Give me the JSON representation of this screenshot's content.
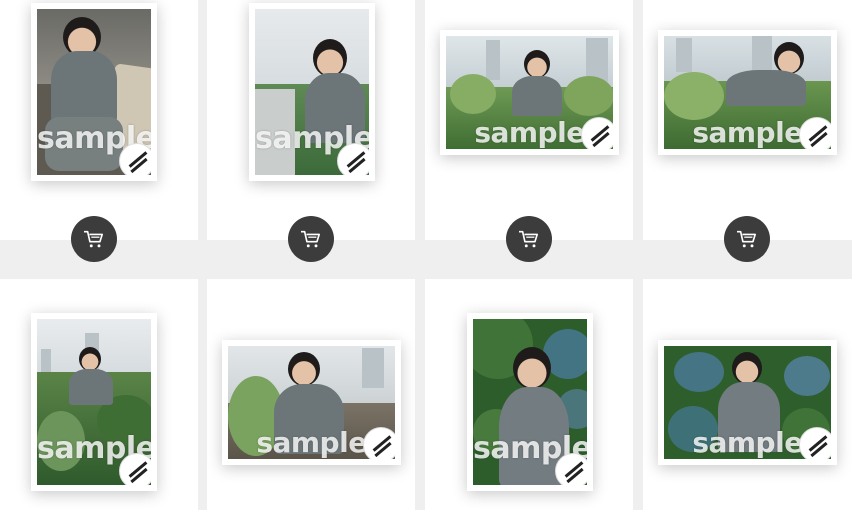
{
  "colors": {
    "page_background": "#efefef",
    "card_background": "#ffffff",
    "cart_button": "#3c3c3c",
    "watermark": "#ffffff"
  },
  "products": [
    {
      "watermark": "sample",
      "orientation": "portrait",
      "cart_icon": "cart-icon",
      "scene": "chair-seated"
    },
    {
      "watermark": "sample",
      "orientation": "portrait",
      "cart_icon": "cart-icon",
      "scene": "rooftop-rail"
    },
    {
      "watermark": "sample",
      "orientation": "landscape",
      "cart_icon": "cart-icon",
      "scene": "shrubs-city"
    },
    {
      "watermark": "sample",
      "orientation": "landscape",
      "cart_icon": "cart-icon",
      "scene": "shrubs-lean"
    },
    {
      "watermark": "sample",
      "orientation": "portrait",
      "cart_icon": "cart-icon",
      "scene": "garden-standing"
    },
    {
      "watermark": "sample",
      "orientation": "landscape",
      "cart_icon": "cart-icon",
      "scene": "fence-smile"
    },
    {
      "watermark": "sample",
      "orientation": "portrait",
      "cart_icon": "cart-icon",
      "scene": "hydrangea-close"
    },
    {
      "watermark": "sample",
      "orientation": "landscape",
      "cart_icon": "cart-icon",
      "scene": "hydrangea-wide"
    }
  ]
}
